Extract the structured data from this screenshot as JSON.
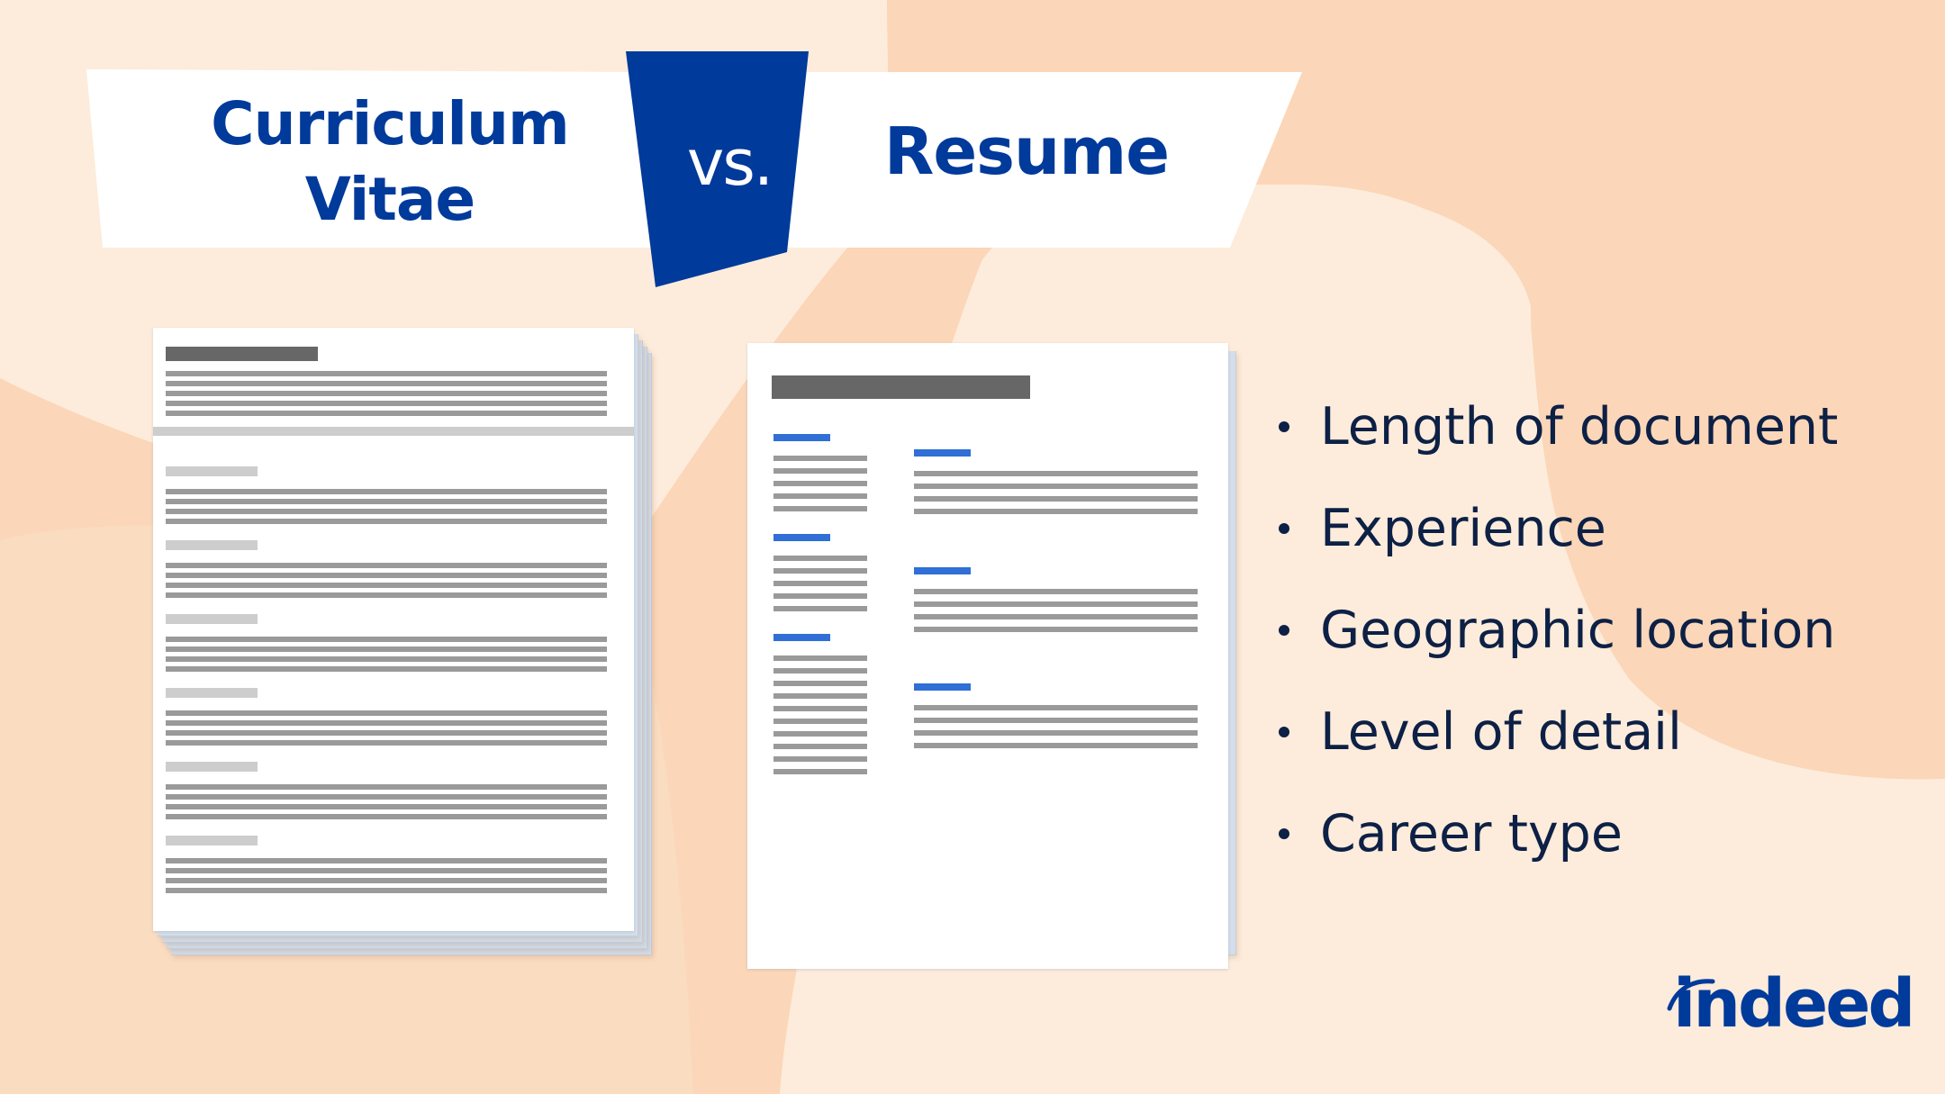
{
  "colors": {
    "background_cream": "#FDECDB",
    "background_peach": "#FBD6B8",
    "background_peach_light": "#FADCC0",
    "brand_blue": "#003A9B",
    "bullet_text": "#0D2045",
    "placeholder_dark": "#676767",
    "placeholder_mid": "#9A9A9A",
    "placeholder_light": "#CDCDCD",
    "accent_blue": "#2F6FD6"
  },
  "header": {
    "left_title_line1": "Curriculum",
    "left_title_line2": "Vitae",
    "versus": "vs.",
    "right_title": "Resume"
  },
  "illustrations": {
    "cv": {
      "label": "multi-page curriculum vitae document",
      "page_count": 5,
      "sections": 6
    },
    "resume": {
      "label": "single-page resume document",
      "page_count": 2,
      "left_sections": 3,
      "right_sections": 3
    }
  },
  "differences": {
    "items": [
      {
        "label": "Length of document"
      },
      {
        "label": "Experience"
      },
      {
        "label": "Geographic location"
      },
      {
        "label": "Level of detail"
      },
      {
        "label": "Career type"
      }
    ]
  },
  "brand": {
    "logo_text": "indeed",
    "logo_icon": "indeed-arc-icon"
  }
}
